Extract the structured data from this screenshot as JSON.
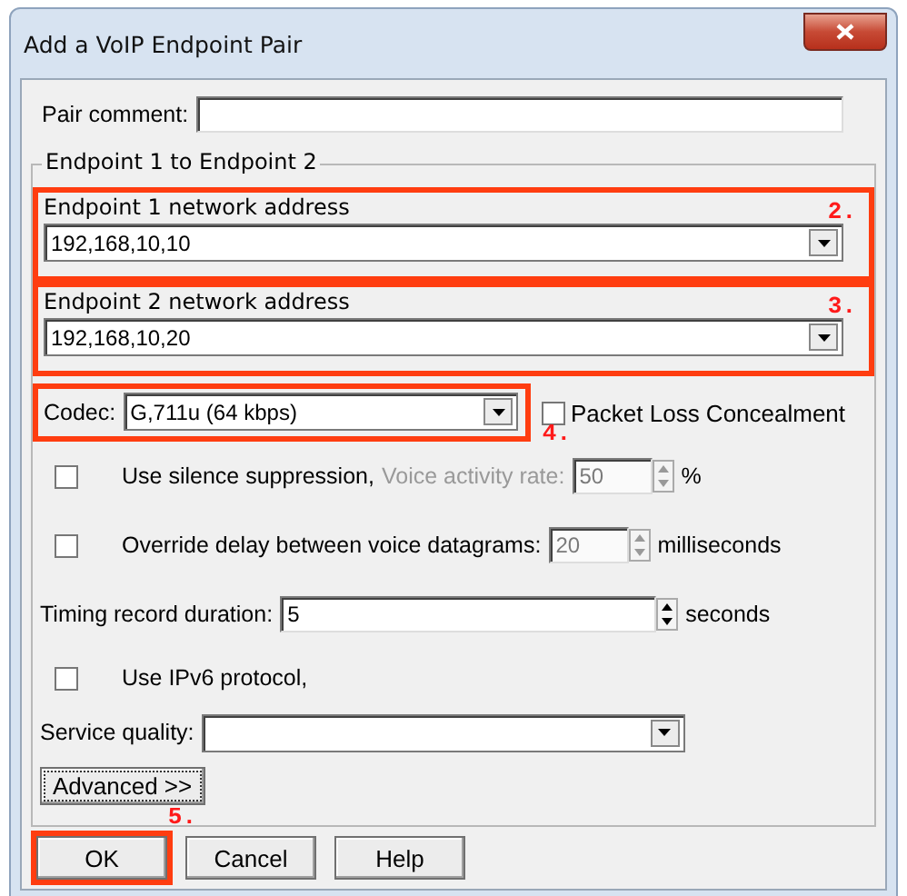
{
  "window": {
    "title": "Add a VoIP Endpoint Pair"
  },
  "pair_comment": {
    "label": "Pair comment:"
  },
  "group": {
    "title": "Endpoint 1 to Endpoint 2",
    "endpoints": [
      {
        "label": "Endpoint 1 network address",
        "value": "192,168,10,10",
        "callout": "2."
      },
      {
        "label": "Endpoint 2 network address",
        "value": "192,168,10,20",
        "callout": "3."
      }
    ],
    "codec": {
      "label": "Codec:",
      "value": "G,711u (64 kbps)",
      "callout": "4."
    },
    "packet_loss": {
      "label": "Packet Loss Concealment",
      "checked": false
    },
    "options": [
      {
        "kind": "check_spin",
        "label": "Use silence suppression,",
        "checked": false,
        "sub_label": "Voice activity rate:",
        "value": "50",
        "unit": "%",
        "disabled": true
      },
      {
        "kind": "check_spin",
        "label": "Override delay between voice datagrams:",
        "checked": false,
        "value": "20",
        "unit": "milliseconds",
        "disabled": true
      },
      {
        "kind": "spin",
        "label": "Timing record duration:",
        "value": "5",
        "unit": "seconds"
      },
      {
        "kind": "check",
        "label": "Use IPv6 protocol,",
        "checked": false
      },
      {
        "kind": "combo",
        "label": "Service quality:"
      },
      {
        "kind": "button",
        "label": "Advanced >>",
        "focused": true
      }
    ]
  },
  "buttons": [
    {
      "label": "OK",
      "callout": "5."
    },
    {
      "label": "Cancel"
    },
    {
      "label": "Help"
    }
  ]
}
